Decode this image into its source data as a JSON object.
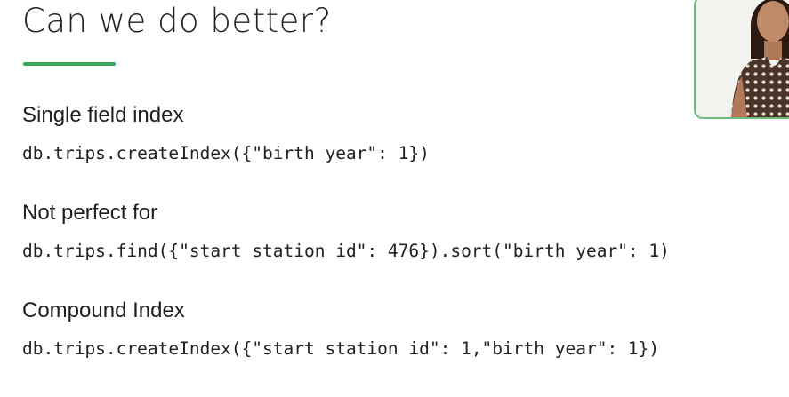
{
  "slide": {
    "title": "Can we do better?",
    "accent_color": "#3aa757",
    "sections": [
      {
        "heading": "Single field index",
        "code": "db.trips.createIndex({\"birth year\": 1})"
      },
      {
        "heading": "Not perfect for",
        "code": "db.trips.find({\"start station id\": 476}).sort(\"birth year\": 1)"
      },
      {
        "heading": "Compound Index",
        "code": "db.trips.createIndex({\"start station id\": 1,\"birth year\": 1})"
      }
    ]
  },
  "presenter_video": {
    "frame_color": "#6dbb7a",
    "icon": "presenter-video-thumbnail"
  }
}
